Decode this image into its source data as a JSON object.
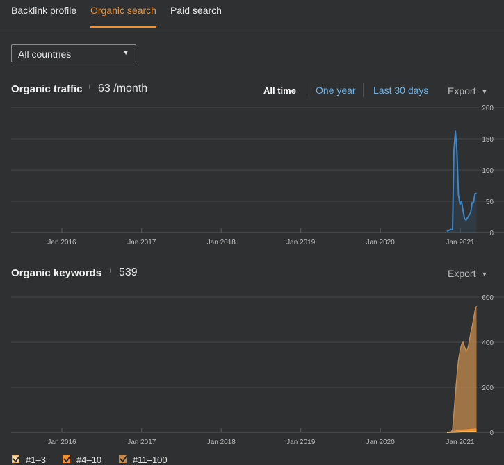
{
  "tabs": [
    {
      "label": "Backlink profile",
      "active": false
    },
    {
      "label": "Organic search",
      "active": true
    },
    {
      "label": "Paid search",
      "active": false
    }
  ],
  "country_select": {
    "value": "All countries"
  },
  "traffic": {
    "title": "Organic traffic",
    "info": "i",
    "value": "63 /month",
    "ranges": [
      "All time",
      "One year",
      "Last 30 days"
    ],
    "selected_range": "All time",
    "export_label": "Export"
  },
  "keywords": {
    "title": "Organic keywords",
    "info": "i",
    "value": "539",
    "export_label": "Export"
  },
  "legend": [
    {
      "label": "#1–3",
      "color": "#f4d7a6"
    },
    {
      "label": "#4–10",
      "color": "#f0912c"
    },
    {
      "label": "#11–100",
      "color": "#c48a4c"
    }
  ],
  "colors": {
    "accent": "#f0912c",
    "line": "#3d87c9",
    "link": "#6cb2e8"
  },
  "chart_data": [
    {
      "type": "line",
      "title": "",
      "xlabel": "",
      "ylabel": "",
      "x_ticks": [
        "Jan 2016",
        "Jan 2017",
        "Jan 2018",
        "Jan 2019",
        "Jan 2020",
        "Jan 2021"
      ],
      "y_ticks": [
        0,
        50,
        100,
        150,
        200
      ],
      "ylim": [
        0,
        200
      ],
      "grid": true,
      "series": [
        {
          "name": "",
          "color": "#3d87c9",
          "x": [
            "2020-11-01",
            "2020-11-20",
            "2020-11-27",
            "2020-12-03",
            "2020-12-10",
            "2020-12-17",
            "2020-12-24",
            "2020-12-31",
            "2021-01-07",
            "2021-01-14",
            "2021-01-21",
            "2021-01-28",
            "2021-02-04",
            "2021-02-11",
            "2021-02-18",
            "2021-02-25",
            "2021-03-03",
            "2021-03-10",
            "2021-03-17"
          ],
          "values": [
            2,
            5,
            5,
            130,
            162,
            130,
            60,
            45,
            50,
            35,
            22,
            20,
            24,
            28,
            32,
            48,
            48,
            62,
            63
          ]
        }
      ]
    },
    {
      "type": "area",
      "title": "",
      "xlabel": "",
      "ylabel": "",
      "x_ticks": [
        "Jan 2016",
        "Jan 2017",
        "Jan 2018",
        "Jan 2019",
        "Jan 2020",
        "Jan 2021"
      ],
      "y_ticks": [
        0,
        200,
        400,
        600
      ],
      "ylim": [
        0,
        600
      ],
      "grid": true,
      "series": [
        {
          "name": "#11–100",
          "color": "#c48a4c",
          "x": [
            "2020-11-01",
            "2020-11-20",
            "2020-11-27",
            "2020-12-03",
            "2020-12-10",
            "2020-12-17",
            "2020-12-24",
            "2020-12-31",
            "2021-01-07",
            "2021-01-14",
            "2021-01-21",
            "2021-01-28",
            "2021-02-04",
            "2021-02-11",
            "2021-02-18",
            "2021-02-25",
            "2021-03-03",
            "2021-03-10",
            "2021-03-17"
          ],
          "values": [
            0,
            2,
            10,
            80,
            170,
            250,
            320,
            360,
            390,
            400,
            380,
            360,
            370,
            400,
            440,
            470,
            500,
            540,
            560
          ]
        },
        {
          "name": "#4–10",
          "color": "#f0912c",
          "x": [
            "2020-11-01",
            "2020-11-20",
            "2020-12-10",
            "2021-01-07",
            "2021-02-04",
            "2021-03-03",
            "2021-03-17"
          ],
          "values": [
            0,
            1,
            6,
            10,
            12,
            15,
            16
          ]
        },
        {
          "name": "#1–3",
          "color": "#f4d7a6",
          "x": [
            "2020-11-01",
            "2020-12-10",
            "2021-01-07",
            "2021-02-04",
            "2021-03-17"
          ],
          "values": [
            0,
            1,
            2,
            2,
            3
          ]
        }
      ]
    }
  ]
}
